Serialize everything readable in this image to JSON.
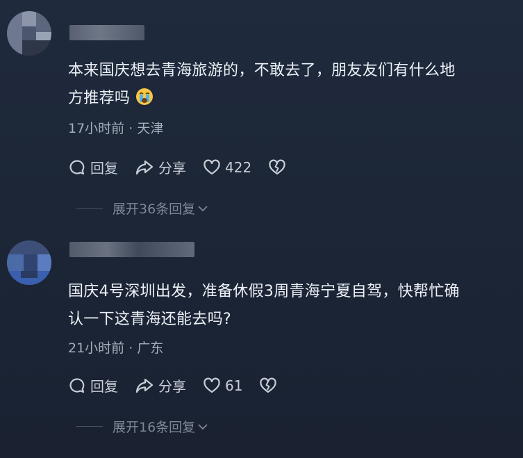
{
  "comments": [
    {
      "text_line1": "本来国庆想去青海旅游的，不敢去了，朋友友们有什么地",
      "text_line2": "方推荐吗",
      "emoji": "crying-face-emoji",
      "time": "17小时前",
      "location": "天津",
      "reply_label": "回复",
      "share_label": "分享",
      "likes": "422",
      "expand_label": "展开36条回复"
    },
    {
      "text_line1": "国庆4号深圳出发，准备休假3周青海宁夏自驾，快帮忙确",
      "text_line2": "认一下这青海还能去吗?",
      "time": "21小时前",
      "location": "广东",
      "reply_label": "回复",
      "share_label": "分享",
      "likes": "61",
      "expand_label": "展开16条回复"
    }
  ],
  "meta_separator": " · ",
  "colors": {
    "background": "#1c2636",
    "text": "#ecf0f6",
    "meta": "#a7aebb",
    "expand": "#7f8797"
  }
}
